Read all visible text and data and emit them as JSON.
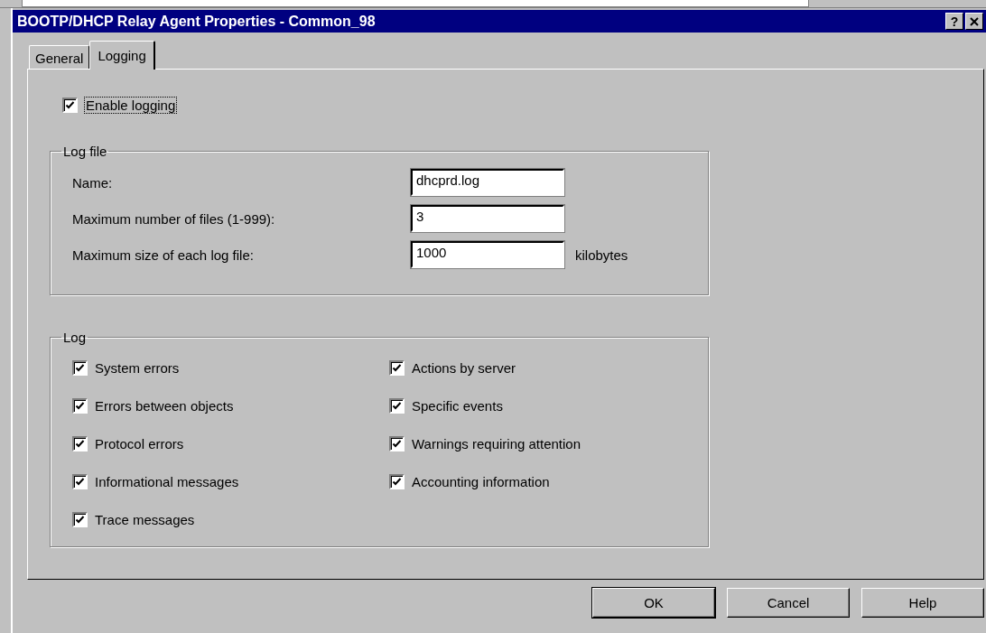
{
  "window": {
    "title": "BOOTP/DHCP Relay Agent Properties - Common_98",
    "help_button": "?"
  },
  "tabs": [
    {
      "label": "General",
      "selected": false
    },
    {
      "label": "Logging",
      "selected": true
    }
  ],
  "enable_logging": {
    "label": "Enable logging",
    "checked": true
  },
  "log_file": {
    "title": "Log file",
    "fields": [
      {
        "label": "Name:",
        "value": "dhcprd.log"
      },
      {
        "label": "Maximum number of files (1-999):",
        "value": "3"
      },
      {
        "label": "Maximum size of each log file:",
        "value": "1000",
        "unit": "kilobytes"
      }
    ]
  },
  "log": {
    "title": "Log",
    "columns": [
      {
        "items": [
          {
            "label": "System errors",
            "checked": true
          },
          {
            "label": "Errors between objects",
            "checked": true
          },
          {
            "label": "Protocol errors",
            "checked": true
          },
          {
            "label": "Informational messages",
            "checked": true
          },
          {
            "label": "Trace messages",
            "checked": true
          }
        ]
      },
      {
        "items": [
          {
            "label": "Actions by server",
            "checked": true
          },
          {
            "label": "Specific events",
            "checked": true
          },
          {
            "label": "Warnings requiring attention",
            "checked": true
          },
          {
            "label": "Accounting information",
            "checked": true
          }
        ]
      }
    ]
  },
  "buttons": [
    {
      "label": "OK",
      "default": true
    },
    {
      "label": "Cancel",
      "default": false
    },
    {
      "label": "Help",
      "default": false
    }
  ]
}
